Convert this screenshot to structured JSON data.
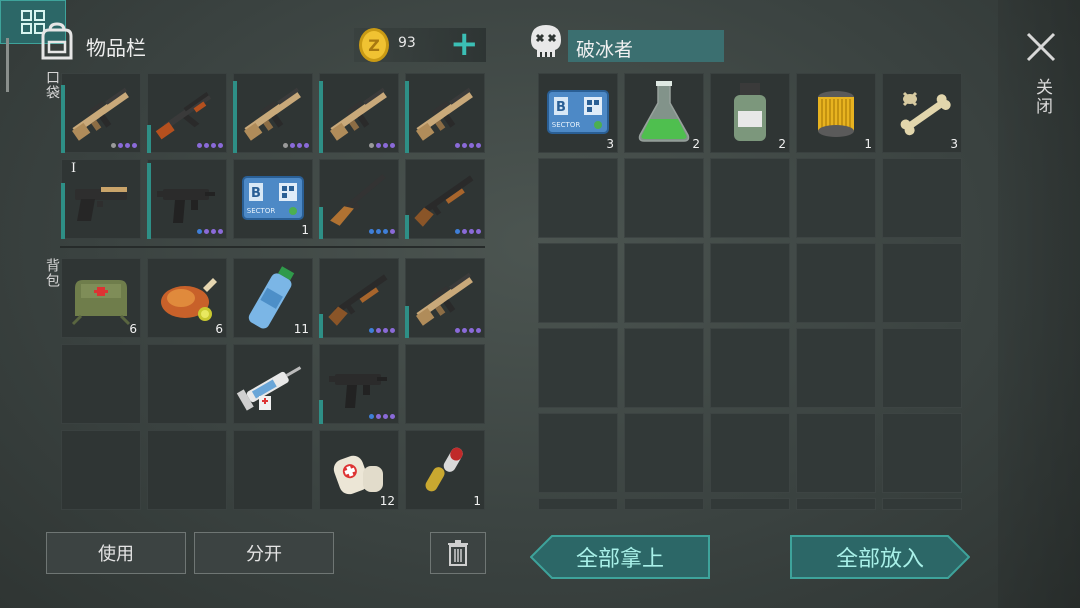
{
  "inventory": {
    "title": "物品栏",
    "coins": "93",
    "coin_symbol": "Z",
    "add_coins": "+",
    "pocket_label": "口袋",
    "backpack_label": "背包",
    "pocket_slots": [
      {
        "item": "assault-rifle-tan",
        "durability": 0.85,
        "dots": [
          "#9a9a9a",
          "#8a6ad8",
          "#8a6ad8",
          "#8a6ad8"
        ]
      },
      {
        "item": "ak-rifle",
        "durability": 0.35,
        "dots": [
          "#8a6ad8",
          "#8a6ad8",
          "#8a6ad8",
          "#8a6ad8"
        ]
      },
      {
        "item": "assault-rifle-tan",
        "durability": 0.9,
        "dots": [
          "#9a9a9a",
          "#8a6ad8",
          "#8a6ad8",
          "#8a6ad8"
        ]
      },
      {
        "item": "assault-rifle-tan",
        "durability": 0.9,
        "dots": [
          "#9a9a9a",
          "#8a6ad8",
          "#8a6ad8",
          "#8a6ad8"
        ]
      },
      {
        "item": "assault-rifle-tan",
        "durability": 0.9,
        "dots": [
          "#8a6ad8",
          "#8a6ad8",
          "#8a6ad8",
          "#8a6ad8"
        ]
      },
      {
        "item": "desert-pistol",
        "durability": 0.7,
        "tier": "I",
        "dots": []
      },
      {
        "item": "uzi-smg",
        "durability": 0.95,
        "dots": [
          "#3f7fd8",
          "#8a6ad8",
          "#8a6ad8",
          "#8a6ad8"
        ]
      },
      {
        "item": "keycard-b",
        "durability": 0,
        "count": "1",
        "dots": []
      },
      {
        "item": "hunting-rifle",
        "durability": 0.4,
        "dots": [
          "#3f7fd8",
          "#3f7fd8",
          "#3f7fd8",
          "#8a6ad8"
        ]
      },
      {
        "item": "shotgun",
        "durability": 0.3,
        "dots": [
          "#3f7fd8",
          "#8a6ad8",
          "#8a6ad8",
          "#8a6ad8"
        ]
      }
    ],
    "backpack_slots": [
      {
        "item": "first-aid-bag",
        "count": "6"
      },
      {
        "item": "roast-chicken",
        "count": "6"
      },
      {
        "item": "water-bottle",
        "count": "11"
      },
      {
        "item": "shotgun",
        "durability": 0.3,
        "dots": [
          "#3f7fd8",
          "#8a6ad8",
          "#8a6ad8",
          "#8a6ad8"
        ]
      },
      {
        "item": "assault-rifle-tan",
        "durability": 0.4,
        "dots": [
          "#8a6ad8",
          "#8a6ad8",
          "#8a6ad8",
          "#8a6ad8"
        ]
      },
      {
        "item": "empty"
      },
      {
        "item": "empty"
      },
      {
        "item": "syringe-injector"
      },
      {
        "item": "uzi-smg",
        "durability": 0.3,
        "dots": [
          "#3f7fd8",
          "#8a6ad8",
          "#8a6ad8",
          "#8a6ad8"
        ]
      },
      {
        "item": "empty"
      },
      {
        "item": "empty"
      },
      {
        "item": "empty"
      },
      {
        "item": "empty"
      },
      {
        "item": "bandages",
        "count": "12"
      },
      {
        "item": "pills",
        "count": "1"
      }
    ],
    "use_label": "使用",
    "split_label": "分开"
  },
  "loot": {
    "name": "破冰者",
    "items": [
      {
        "item": "keycard-b",
        "count": "3"
      },
      {
        "item": "green-chemical-flask",
        "count": "2"
      },
      {
        "item": "acid-bottle",
        "count": "2"
      },
      {
        "item": "filter",
        "count": "1"
      },
      {
        "item": "bones",
        "count": "3"
      }
    ],
    "rows": 6,
    "cols": 5,
    "take_all_label": "全部拿上",
    "put_all_label": "全部放入"
  },
  "close_label": "关闭",
  "keycard": {
    "letter": "B",
    "text": "SECTOR"
  },
  "colors": {
    "accent": "#3bbfb5",
    "dur_bar": "#2e8f86",
    "slot_bg": "#2f3534",
    "name_box": "#3b6f70"
  }
}
